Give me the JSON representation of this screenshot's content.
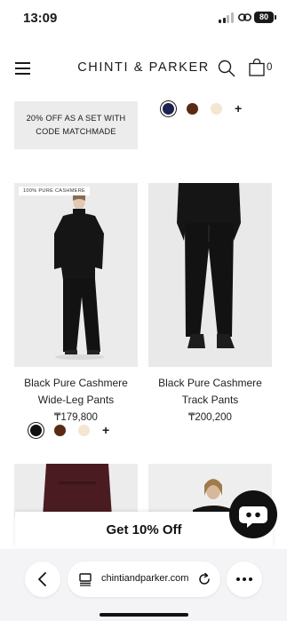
{
  "status_bar": {
    "time": "13:09",
    "battery": "80"
  },
  "header": {
    "brand": "CHINTI & PARKER",
    "bag_count": "0"
  },
  "promo": {
    "text": "20% OFF AS A SET WITH CODE MATCHMADE"
  },
  "top_swatches": {
    "colors": [
      "#1b2150",
      "#5a2a14",
      "#f4e6d0"
    ],
    "selected_index": 0,
    "more": "+"
  },
  "products": [
    {
      "badge": "100% PURE CASHMERE",
      "name": "Black Pure Cashmere Wide-Leg Pants",
      "price": "₸179,800",
      "swatches": [
        "#111111",
        "#5a2a14",
        "#f4e6d0"
      ],
      "selected_index": 0,
      "more": "+"
    },
    {
      "badge": "",
      "name": "Black Pure Cashmere Track Pants",
      "price": "₸200,200"
    }
  ],
  "offer_bar": {
    "label": "Get 10% Off"
  },
  "browser": {
    "url": "chintiandparker.com"
  },
  "colors": {
    "image_bg": "#ececec",
    "offer_bar": "#ffffff",
    "chat_button": "#111111",
    "browser_bar": "#f4f4f6"
  }
}
